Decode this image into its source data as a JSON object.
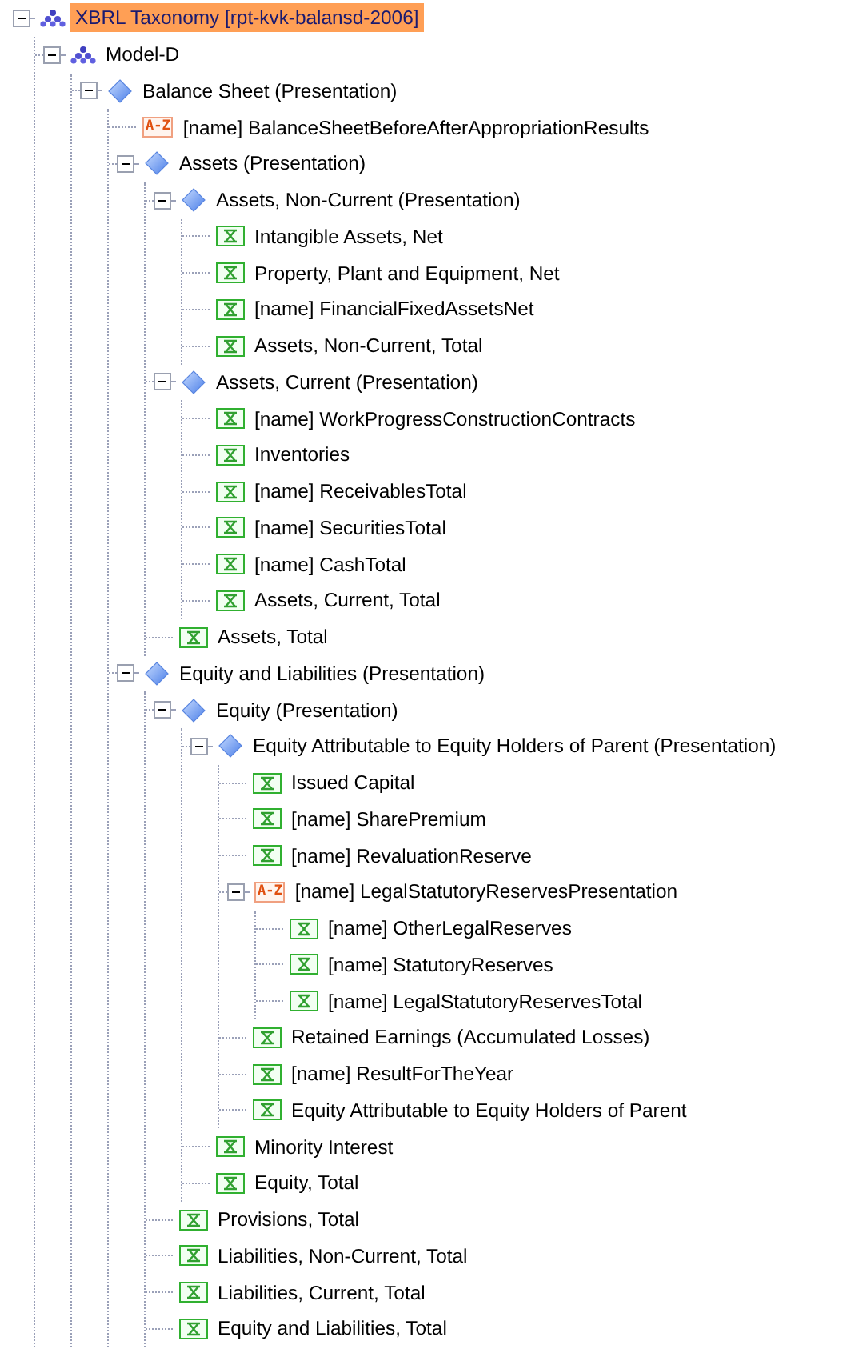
{
  "tree": [
    {
      "label": "XBRL Taxonomy [rpt-kvk-balansd-2006]",
      "kind": "taxonomy",
      "selected": true,
      "expanded": true,
      "children": [
        {
          "label": "Model-D",
          "kind": "taxonomy",
          "selected": false,
          "expanded": true,
          "children": [
            {
              "label": "Balance Sheet (Presentation)",
              "kind": "presentation",
              "selected": false,
              "expanded": true,
              "children": [
                {
                  "label": "[name] BalanceSheetBeforeAfterAppropriationResults",
                  "kind": "names",
                  "badge": "A-Z",
                  "selected": false
                },
                {
                  "label": "Assets (Presentation)",
                  "kind": "presentation",
                  "selected": false,
                  "expanded": true,
                  "children": [
                    {
                      "label": "Assets, Non-Current (Presentation)",
                      "kind": "presentation",
                      "selected": false,
                      "expanded": true,
                      "children": [
                        {
                          "label": "Intangible Assets, Net",
                          "kind": "concept",
                          "selected": false
                        },
                        {
                          "label": "Property, Plant and Equipment, Net",
                          "kind": "concept",
                          "selected": false
                        },
                        {
                          "label": "[name] FinancialFixedAssetsNet",
                          "kind": "concept",
                          "selected": false
                        },
                        {
                          "label": "Assets, Non-Current, Total",
                          "kind": "concept",
                          "selected": false
                        }
                      ]
                    },
                    {
                      "label": "Assets, Current (Presentation)",
                      "kind": "presentation",
                      "selected": false,
                      "expanded": true,
                      "children": [
                        {
                          "label": "[name] WorkProgressConstructionContracts",
                          "kind": "concept",
                          "selected": false
                        },
                        {
                          "label": "Inventories",
                          "kind": "concept",
                          "selected": false
                        },
                        {
                          "label": "[name] ReceivablesTotal",
                          "kind": "concept",
                          "selected": false
                        },
                        {
                          "label": "[name] SecuritiesTotal",
                          "kind": "concept",
                          "selected": false
                        },
                        {
                          "label": "[name] CashTotal",
                          "kind": "concept",
                          "selected": false
                        },
                        {
                          "label": "Assets, Current, Total",
                          "kind": "concept",
                          "selected": false
                        }
                      ]
                    },
                    {
                      "label": "Assets, Total",
                      "kind": "concept",
                      "selected": false
                    }
                  ]
                },
                {
                  "label": "Equity and Liabilities (Presentation)",
                  "kind": "presentation",
                  "selected": false,
                  "expanded": true,
                  "children": [
                    {
                      "label": "Equity (Presentation)",
                      "kind": "presentation",
                      "selected": false,
                      "expanded": true,
                      "children": [
                        {
                          "label": "Equity Attributable to Equity Holders of Parent (Presentation)",
                          "kind": "presentation",
                          "selected": false,
                          "expanded": true,
                          "children": [
                            {
                              "label": "Issued Capital",
                              "kind": "concept",
                              "selected": false
                            },
                            {
                              "label": "[name] SharePremium",
                              "kind": "concept",
                              "selected": false
                            },
                            {
                              "label": "[name] RevaluationReserve",
                              "kind": "concept",
                              "selected": false
                            },
                            {
                              "label": "[name] LegalStatutoryReservesPresentation",
                              "kind": "names",
                              "badge": "A-Z",
                              "selected": false,
                              "expanded": true,
                              "children": [
                                {
                                  "label": "[name] OtherLegalReserves",
                                  "kind": "concept",
                                  "selected": false
                                },
                                {
                                  "label": "[name] StatutoryReserves",
                                  "kind": "concept",
                                  "selected": false
                                },
                                {
                                  "label": "[name] LegalStatutoryReservesTotal",
                                  "kind": "concept",
                                  "selected": false
                                }
                              ]
                            },
                            {
                              "label": "Retained Earnings (Accumulated Losses)",
                              "kind": "concept",
                              "selected": false
                            },
                            {
                              "label": "[name] ResultForTheYear",
                              "kind": "concept",
                              "selected": false
                            },
                            {
                              "label": "Equity Attributable to Equity Holders of Parent",
                              "kind": "concept",
                              "selected": false
                            }
                          ]
                        },
                        {
                          "label": "Minority Interest",
                          "kind": "concept",
                          "selected": false
                        },
                        {
                          "label": "Equity, Total",
                          "kind": "concept",
                          "selected": false
                        }
                      ]
                    },
                    {
                      "label": "Provisions, Total",
                      "kind": "concept",
                      "selected": false
                    },
                    {
                      "label": "Liabilities, Non-Current, Total",
                      "kind": "concept",
                      "selected": false
                    },
                    {
                      "label": "Liabilities, Current, Total",
                      "kind": "concept",
                      "selected": false
                    },
                    {
                      "label": "Equity and Liabilities, Total",
                      "kind": "concept",
                      "selected": false
                    }
                  ]
                }
              ]
            }
          ]
        }
      ]
    }
  ]
}
